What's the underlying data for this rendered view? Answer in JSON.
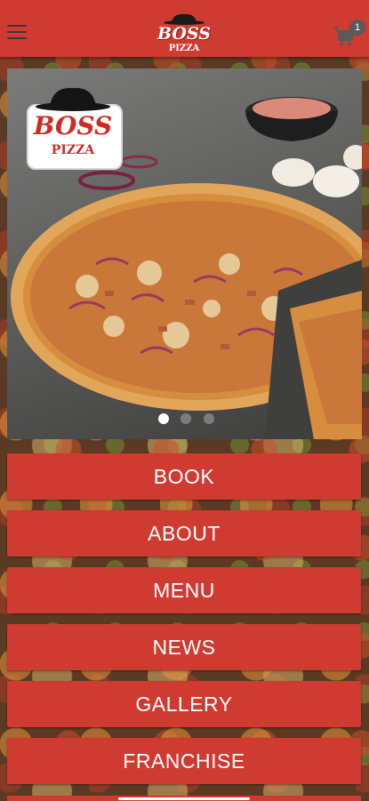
{
  "app": {
    "cart_count": "1"
  },
  "logo": {
    "line1": "BOSS",
    "line2": "PIZZA"
  },
  "colors": {
    "brand_red": "#cf3a31",
    "button_text": "#ffffff"
  },
  "icons": {
    "menu": "hamburger-icon",
    "cart": "shopping-cart-icon",
    "hat": "fedora-hat-icon"
  },
  "carousel": {
    "slide_logo": {
      "line1": "BOSS",
      "line2": "PIZZA"
    },
    "slide_count": 3,
    "active_index": 0
  },
  "nav": {
    "buttons": [
      {
        "label": "BOOK"
      },
      {
        "label": "ABOUT"
      },
      {
        "label": "MENU"
      },
      {
        "label": "NEWS"
      },
      {
        "label": "GALLERY"
      },
      {
        "label": "FRANCHISE"
      }
    ]
  }
}
